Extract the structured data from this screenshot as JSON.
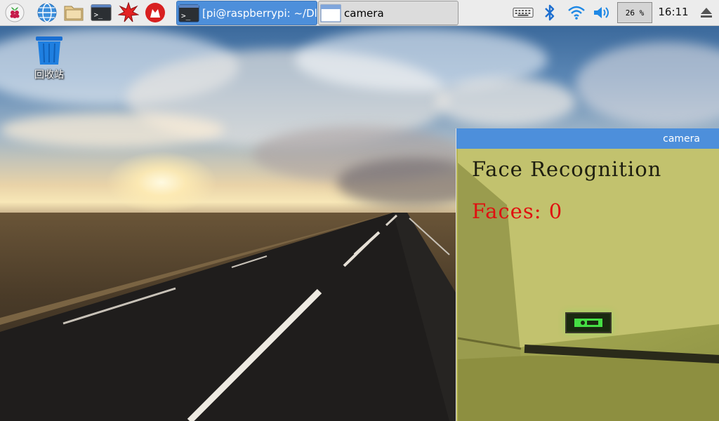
{
  "taskbar": {
    "launchers": [
      {
        "name": "menu",
        "icon": "raspberry-icon"
      },
      {
        "name": "browser",
        "icon": "globe-icon"
      },
      {
        "name": "file-manager",
        "icon": "folder-icon"
      },
      {
        "name": "terminal",
        "icon": "terminal-icon"
      },
      {
        "name": "math",
        "icon": "starburst-icon"
      },
      {
        "name": "wolfram",
        "icon": "wolf-icon"
      }
    ],
    "tasks": [
      {
        "label": "[pi@raspberrypi: ~/Dl…",
        "active": true,
        "icon": "terminal-icon"
      },
      {
        "label": "camera",
        "active": false,
        "icon": "window-icon"
      }
    ],
    "tray": {
      "cpu": "26 %",
      "clock": "16:11",
      "icons": [
        "keyboard-icon",
        "bluetooth-icon",
        "wifi-icon",
        "volume-icon",
        "eject-icon"
      ]
    }
  },
  "desktop": {
    "trash_label": "回收站"
  },
  "camera_window": {
    "title": "camera",
    "overlay_title": "Face Recognition",
    "overlay_faces": "Faces: 0"
  },
  "colors": {
    "accent": "#4d8fdb",
    "faces_text": "#e01010",
    "taskbar_bg": "#ececec"
  }
}
